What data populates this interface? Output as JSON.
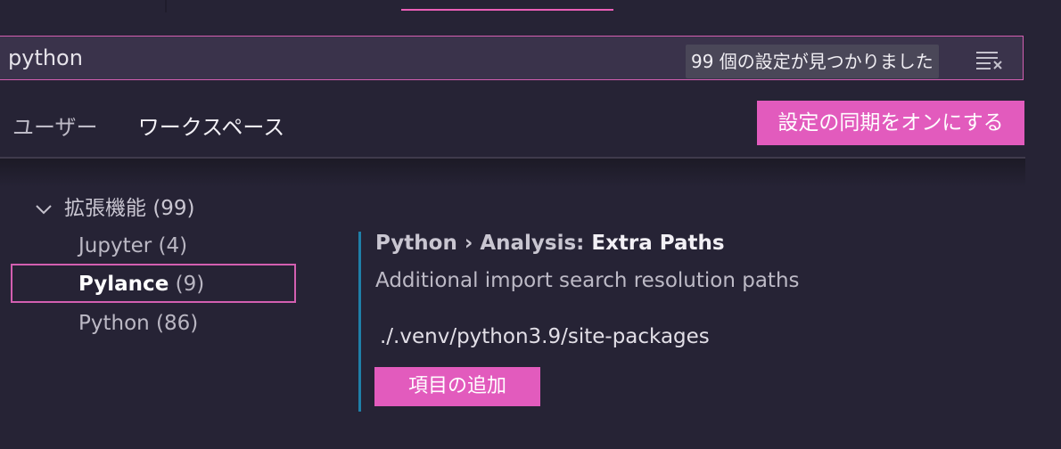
{
  "search": {
    "value": "python",
    "result_count": "99 個の設定が見つかりました",
    "clear_icon": "clear-filter-icon"
  },
  "tabs": [
    {
      "label": "ユーザー"
    },
    {
      "label": "ワークスペース"
    }
  ],
  "sync_button_label": "設定の同期をオンにする",
  "toc": {
    "group": {
      "label": "拡張機能",
      "count": "(99)"
    },
    "items": [
      {
        "label": "Jupyter",
        "count": "(4)"
      },
      {
        "label": "Pylance",
        "count": "(9)"
      },
      {
        "label": "Python",
        "count": "(86)"
      }
    ]
  },
  "setting": {
    "category": "Python › Analysis: ",
    "name": "Extra Paths",
    "description": "Additional import search resolution paths",
    "value": "./.venv/python3.9/site-packages",
    "add_button_label": "項目の追加"
  },
  "colors": {
    "accent": "#e25bbd",
    "background": "#262335",
    "search_background": "#3a334b",
    "indicator": "#1f7fa8"
  }
}
